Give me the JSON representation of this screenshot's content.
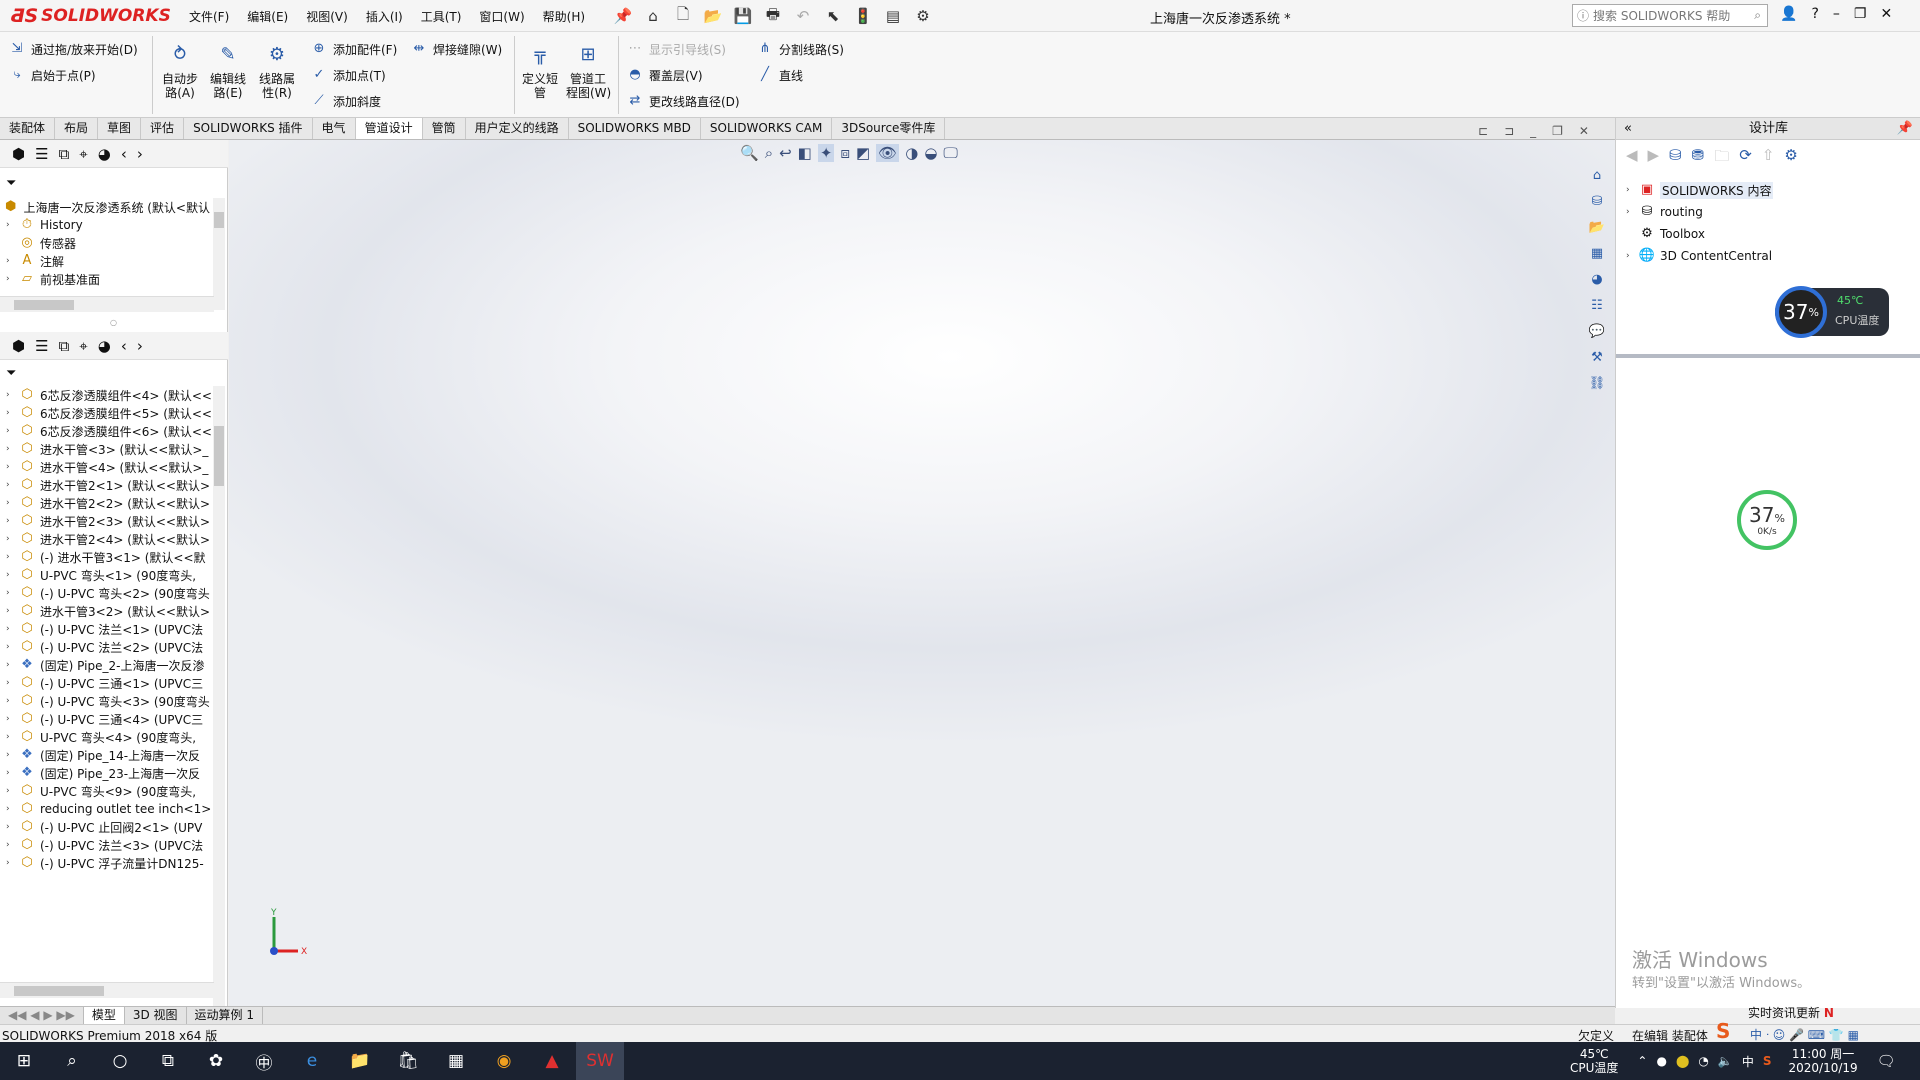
{
  "app": {
    "brand": "SOLIDWORKS",
    "document_title": "上海唐一次反渗透系统 *"
  },
  "menu": [
    "文件(F)",
    "编辑(E)",
    "视图(V)",
    "插入(I)",
    "工具(T)",
    "窗口(W)",
    "帮助(H)"
  ],
  "help_search": {
    "placeholder": "搜索 SOLIDWORKS 帮助"
  },
  "commands": {
    "drag_zoom_start": "通过拖/放来开始(D)",
    "start_at_point": "启始于点(P)",
    "auto_route": "自动步\n路(A)",
    "edit_route": "编辑线\n路(E)",
    "route_props": "线路属\n性(R)",
    "add_fitting": "添加配件(F)",
    "add_point": "添加点(T)",
    "add_slope": "添加斜度",
    "weld_gap": "焊接缝隙(W)",
    "custom_pipe": "定义短\n管",
    "pipe_drawing": "管道工\n程图(W)",
    "show_guidelines": "显示引导线(S)",
    "cover_layer": "覆盖层(V)",
    "change_route_dia": "更改线路直径(D)",
    "split_route": "分割线路(S)",
    "line": "直线"
  },
  "tabs": [
    {
      "label": "装配体",
      "active": false
    },
    {
      "label": "布局",
      "active": false
    },
    {
      "label": "草图",
      "active": false
    },
    {
      "label": "评估",
      "active": false
    },
    {
      "label": "SOLIDWORKS 插件",
      "active": false
    },
    {
      "label": "电气",
      "active": false
    },
    {
      "label": "管道设计",
      "active": true
    },
    {
      "label": "管筒",
      "active": false
    },
    {
      "label": "用户定义的线路",
      "active": false
    },
    {
      "label": "SOLIDWORKS MBD",
      "active": false
    },
    {
      "label": "SOLIDWORKS CAM",
      "active": false
    },
    {
      "label": "3DSource零件库",
      "active": false
    }
  ],
  "tree_top": [
    {
      "label": "上海唐一次反渗透系统 (默认<默认",
      "icon": "assembly-icon"
    },
    {
      "label": "History",
      "icon": "history-icon"
    },
    {
      "label": "传感器",
      "icon": "sensor-icon"
    },
    {
      "label": "注解",
      "icon": "annotation-icon"
    },
    {
      "label": "前视基准面",
      "icon": "plane-icon"
    }
  ],
  "tree_components": [
    "6芯反渗透膜组件<4> (默认<<",
    "6芯反渗透膜组件<5> (默认<<",
    "6芯反渗透膜组件<6> (默认<<",
    "进水干管<3> (默认<<默认>_",
    "进水干管<4> (默认<<默认>_",
    "进水干管2<1> (默认<<默认>",
    "进水干管2<2> (默认<<默认>",
    "进水干管2<3> (默认<<默认>",
    "进水干管2<4> (默认<<默认>",
    "(-) 进水干管3<1> (默认<<默",
    "U-PVC 弯头<1> (90度弯头,",
    "(-) U-PVC 弯头<2> (90度弯头",
    "进水干管3<2> (默认<<默认>",
    "(-) U-PVC 法兰<1> (UPVC法",
    "(-) U-PVC 法兰<2> (UPVC法",
    "(固定) Pipe_2-上海唐一次反渗",
    "(-) U-PVC 三通<1> (UPVC三",
    "(-) U-PVC 弯头<3> (90度弯头",
    "(-) U-PVC 三通<4> (UPVC三",
    "U-PVC 弯头<4> (90度弯头,",
    "(固定) Pipe_14-上海唐一次反",
    "(固定) Pipe_23-上海唐一次反",
    "U-PVC 弯头<9> (90度弯头,",
    "reducing outlet tee inch<1>",
    "(-) U-PVC 止回阀2<1> (UPV",
    "(-) U-PVC 法兰<3> (UPVC法",
    "(-) U-PVC 浮子流量计DN125-"
  ],
  "bottom_tabs": [
    {
      "label": "模型",
      "active": true
    },
    {
      "label": "3D 视图",
      "active": false
    },
    {
      "label": "运动算例 1",
      "active": false
    }
  ],
  "triad": {
    "y": "Y",
    "x": "X"
  },
  "design_library": {
    "title": "设计库",
    "items": [
      "SOLIDWORKS 内容",
      "routing",
      "Toolbox",
      "3D ContentCentral"
    ]
  },
  "cpu_widget": {
    "percent": "37",
    "unit": "%",
    "temp": "45℃",
    "label": "CPU温度"
  },
  "net_widget": {
    "percent": "37",
    "unit": "%",
    "speed": "0K/s"
  },
  "watermark": {
    "line1": "激活 Windows",
    "line2": "转到\"设置\"以激活 Windows。"
  },
  "news": "实时资讯更新",
  "status": {
    "left": "SOLIDWORKS Premium 2018 x64 版",
    "underdefined": "欠定义",
    "editing": "在编辑 装配体"
  },
  "taskbar": {
    "temp": "45℃",
    "temp_label": "CPU温度",
    "ime": "中",
    "time": "11:00 周一",
    "date": "2020/10/19"
  },
  "colors": {
    "brand_red": "#d22222",
    "accent_blue": "#2a5ca8",
    "taskbar": "#1b2230"
  }
}
